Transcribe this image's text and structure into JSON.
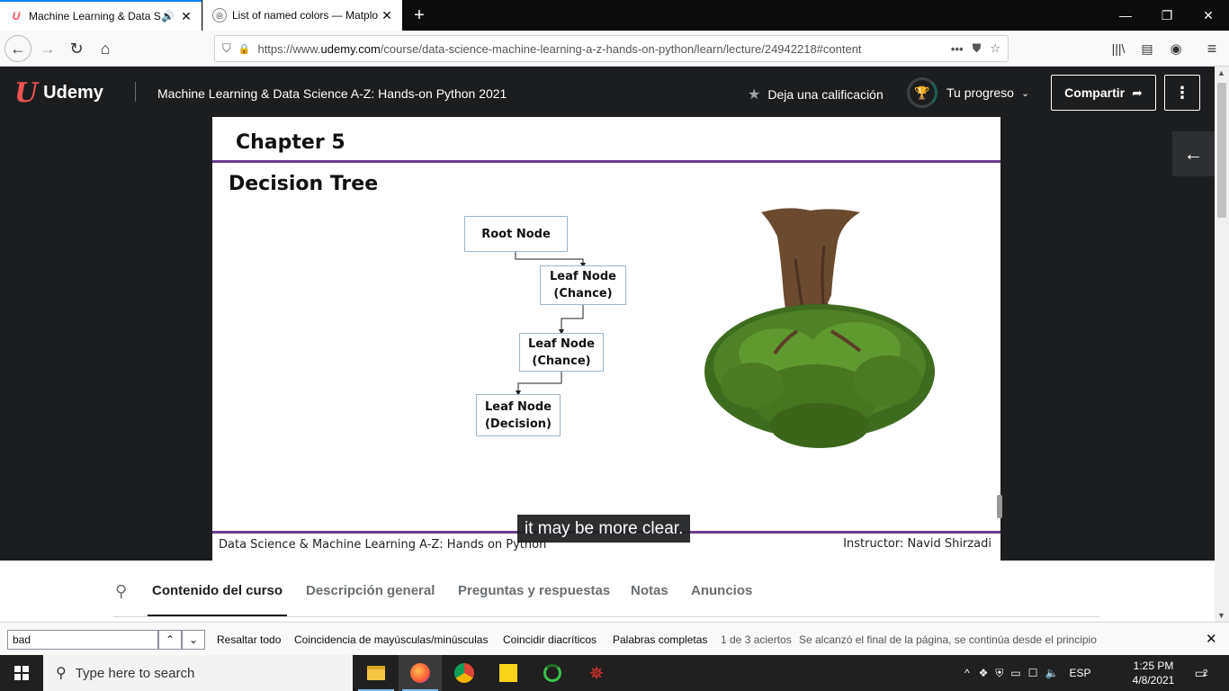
{
  "browser": {
    "tabs": [
      {
        "title": "Machine Learning & Data Sc",
        "favicon": "udemy-icon",
        "audio": true
      },
      {
        "title": "List of named colors — Matplo",
        "favicon": "matplotlib-icon"
      }
    ],
    "url_prefix": "https://www.",
    "url_domain": "udemy.com",
    "url_path": "/course/data-science-machine-learning-a-z-hands-on-python/learn/lecture/24942218#content"
  },
  "udemy": {
    "logo_text": "Udemy",
    "course_title": "Machine Learning & Data Science A-Z: Hands-on Python 2021",
    "rate_label": "Deja una calificación",
    "progress_label": "Tu progreso",
    "share_label": "Compartir"
  },
  "slide": {
    "chapter": "Chapter 5",
    "title": "Decision Tree",
    "nodes": {
      "root": "Root Node",
      "leaf1_line1": "Leaf Node",
      "leaf1_line2": "(Chance)",
      "leaf2_line1": "Leaf Node",
      "leaf2_line2": "(Chance)",
      "leaf3_line1": "Leaf Node",
      "leaf3_line2": "(Decision)"
    },
    "footer_left": "Data Science & Machine Learning A-Z: Hands on Python",
    "footer_right": "Instructor: Navid Shirzadi",
    "caption": "it may be more clear."
  },
  "course_tabs": [
    {
      "label": "Contenido del curso",
      "active": true
    },
    {
      "label": "Descripción general"
    },
    {
      "label": "Preguntas y respuestas"
    },
    {
      "label": "Notas"
    },
    {
      "label": "Anuncios"
    }
  ],
  "findbar": {
    "query": "bad",
    "highlight_all": "Resaltar todo",
    "match_case": "Coincidencia de mayúsculas/minúsculas",
    "match_diacritics": "Coincidir diacríticos",
    "whole_words": "Palabras completas",
    "match_count": "1 de 3 aciertos",
    "wrap_notice": "Se alcanzó el final de la página, se continúa desde el principio"
  },
  "taskbar": {
    "search_placeholder": "Type here to search",
    "language": "ESP",
    "time": "1:25 PM",
    "date": "4/8/2021",
    "notifications": "2"
  },
  "colors": {
    "udemy_dark": "#1c1d1f",
    "udemy_red": "#ec5252",
    "slide_purple": "#6a3d8f"
  }
}
